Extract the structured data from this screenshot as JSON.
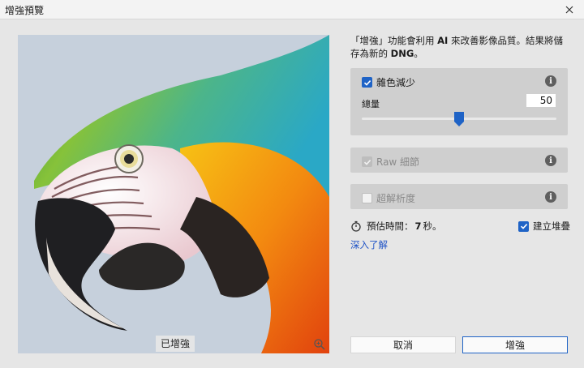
{
  "window": {
    "title": "增強預覽"
  },
  "preview": {
    "label": "已增強"
  },
  "description": {
    "part1": "「增強」功能會利用 ",
    "ai": "AI",
    "part2": " 來改善影像品質。結果將儲存為新的 ",
    "dng": "DNG",
    "part3": "。"
  },
  "noise_reduction": {
    "label": "雜色減少",
    "checked": true,
    "amount_label": "總量",
    "amount": "50",
    "amount_fraction": 0.5
  },
  "raw_details": {
    "label": "Raw 細節",
    "checked": true,
    "disabled": true
  },
  "super_resolution": {
    "label": "超解析度",
    "checked": false
  },
  "estimate": {
    "prefix": "預估時間：",
    "value": "7",
    "suffix": "秒。"
  },
  "create_stack": {
    "label": "建立堆疊",
    "checked": true
  },
  "learn_more": "深入了解",
  "buttons": {
    "cancel": "取消",
    "enhance": "增強"
  },
  "colors": {
    "accent": "#1f63c6",
    "link": "#1f53c6"
  }
}
